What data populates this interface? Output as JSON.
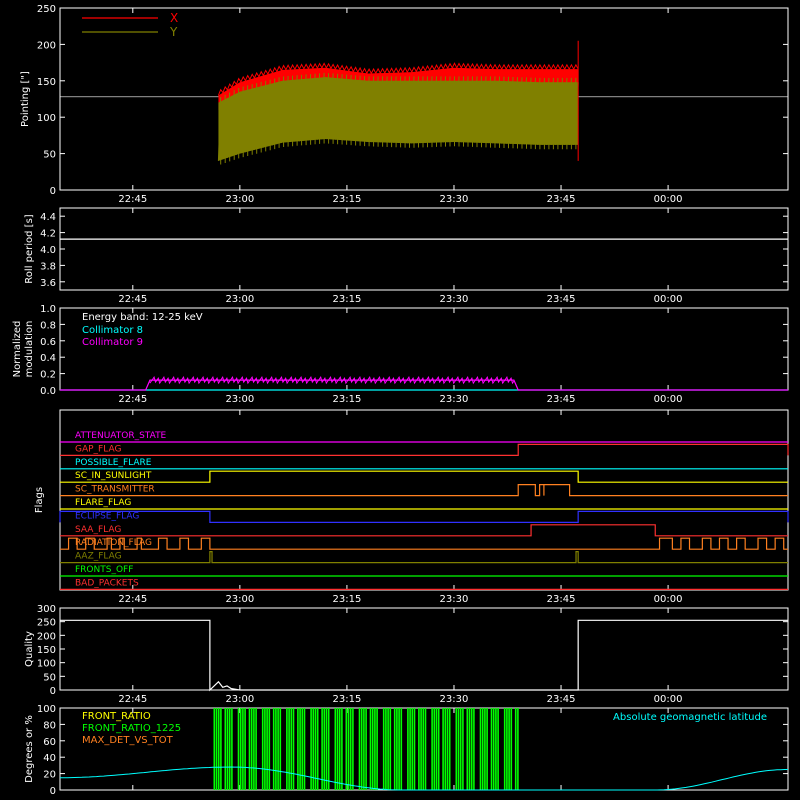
{
  "time_ticks": [
    "22:45",
    "23:00",
    "23:15",
    "23:30",
    "23:45",
    "00:00"
  ],
  "time_tick_hours": [
    22.75,
    23.0,
    23.25,
    23.5,
    23.75,
    24.0
  ],
  "time_range": [
    22.58,
    24.28
  ],
  "chart_data": [
    {
      "type": "area",
      "ylabel": "Pointing [\"]",
      "ylim": [
        0,
        250
      ],
      "yticks": [
        0,
        50,
        100,
        150,
        200,
        250
      ],
      "legend": "top-left",
      "series": [
        {
          "name": "X",
          "color": "#ff0000",
          "x": [
            22.95,
            23.0,
            23.1,
            23.2,
            23.3,
            23.4,
            23.5,
            23.6,
            23.7,
            23.79
          ],
          "upper": [
            130,
            148,
            165,
            168,
            160,
            162,
            168,
            166,
            166,
            166
          ],
          "lower": [
            110,
            130,
            145,
            146,
            140,
            142,
            148,
            146,
            146,
            145
          ]
        },
        {
          "name": "Y",
          "color": "#808000",
          "x": [
            22.95,
            23.0,
            23.1,
            23.2,
            23.3,
            23.4,
            23.5,
            23.6,
            23.7,
            23.79
          ],
          "upper": [
            120,
            135,
            150,
            155,
            150,
            150,
            150,
            150,
            148,
            148
          ],
          "lower": [
            40,
            50,
            65,
            70,
            66,
            64,
            66,
            64,
            62,
            62
          ]
        }
      ],
      "reference_level": 128
    },
    {
      "type": "line",
      "ylabel": "Roll period [s]",
      "ylim": [
        3.5,
        4.5
      ],
      "yticks": [
        3.6,
        3.8,
        4.0,
        4.2,
        4.4
      ],
      "series": [
        {
          "name": "",
          "color": "#ffffff",
          "x": [
            22.58,
            24.28
          ],
          "y": [
            4.12,
            4.12
          ]
        }
      ]
    },
    {
      "type": "line",
      "ylabel": "Normalized modulation",
      "ylim": [
        0,
        1.0
      ],
      "yticks": [
        0.0,
        0.2,
        0.4,
        0.6,
        0.8,
        1.0
      ],
      "annotation": "Energy band: 12-25 keV",
      "series": [
        {
          "name": "Collimator 8",
          "color": "#00ffff",
          "x": [
            22.58,
            24.28
          ],
          "y": [
            0.0,
            0.0
          ]
        },
        {
          "name": "Collimator 9",
          "color": "#ff00ff",
          "x": [
            22.58,
            22.78,
            22.79,
            23.64,
            23.65,
            24.28
          ],
          "y": [
            0.0,
            0.0,
            0.12,
            0.12,
            0.0,
            0.0
          ]
        }
      ]
    },
    {
      "type": "line",
      "ylabel": "Flags",
      "series": [
        {
          "name": "ATTENUATOR_STATE",
          "color": "#ff00ff",
          "segments": []
        },
        {
          "name": "GAP_FLAG",
          "color": "#ff3030",
          "segments": [
            [
              23.65,
              24.28
            ]
          ]
        },
        {
          "name": "POSSIBLE_FLARE",
          "color": "#00ffff",
          "segments": []
        },
        {
          "name": "SC_IN_SUNLIGHT",
          "color": "#ffff00",
          "segments": [
            [
              22.93,
              23.79
            ]
          ]
        },
        {
          "name": "SC_TRANSMITTER",
          "color": "#ff8020",
          "segments": [
            [
              23.65,
              23.69
            ],
            [
              23.7,
              23.71
            ],
            [
              23.71,
              23.77
            ]
          ]
        },
        {
          "name": "FLARE_FLAG",
          "color": "#ffff00",
          "segments": []
        },
        {
          "name": "ECLIPSE_FLAG",
          "color": "#3030ff",
          "segments": [
            [
              22.58,
              22.93
            ],
            [
              23.79,
              24.28
            ]
          ]
        },
        {
          "name": "SAA_FLAG",
          "color": "#ff3030",
          "segments": [
            [
              23.68,
              23.97
            ]
          ]
        },
        {
          "name": "RADIATION_FLAG",
          "color": "#ff8020",
          "segments": [
            [
              22.6,
              22.62
            ],
            [
              22.64,
              22.66
            ],
            [
              22.69,
              22.7
            ],
            [
              22.72,
              22.73
            ],
            [
              22.76,
              22.77
            ],
            [
              22.81,
              22.83
            ],
            [
              22.86,
              22.88
            ],
            [
              22.91,
              22.93
            ],
            [
              23.98,
              24.01
            ],
            [
              24.03,
              24.05
            ],
            [
              24.08,
              24.1
            ],
            [
              24.12,
              24.14
            ],
            [
              24.16,
              24.18
            ],
            [
              24.21,
              24.23
            ],
            [
              24.25,
              24.27
            ]
          ]
        },
        {
          "name": "AAZ_FLAG",
          "color": "#808000",
          "segments": [
            [
              22.93,
              22.935
            ],
            [
              23.785,
              23.79
            ]
          ]
        },
        {
          "name": "FRONTS_OFF",
          "color": "#00ff00",
          "segments": []
        },
        {
          "name": "BAD_PACKETS",
          "color": "#ff3030",
          "segments": []
        }
      ]
    },
    {
      "type": "line",
      "ylabel": "Quality",
      "ylim": [
        0,
        300
      ],
      "yticks": [
        0,
        50,
        100,
        150,
        200,
        250,
        300
      ],
      "series": [
        {
          "name": "",
          "color": "#ffffff",
          "x": [
            22.58,
            22.93,
            22.93,
            22.95,
            22.96,
            22.97,
            22.98,
            23.0,
            23.79,
            23.79,
            24.28
          ],
          "y": [
            255,
            255,
            0,
            30,
            10,
            15,
            5,
            0,
            0,
            255,
            255
          ]
        }
      ]
    },
    {
      "type": "bar",
      "ylabel": "Degrees or %",
      "ylim": [
        0,
        100
      ],
      "yticks": [
        0,
        20,
        40,
        60,
        80,
        100
      ],
      "legend": "top-left",
      "annotation": "Absolute geomagnetic latitude",
      "annotation_color": "#00ffff",
      "series": [
        {
          "name": "FRONT_RATIO",
          "color": "#ffff00"
        },
        {
          "name": "FRONT_RATIO_1225",
          "color": "#00ff00",
          "range": [
            22.93,
            23.65
          ],
          "value": 100
        },
        {
          "name": "MAX_DET_VS_TOT",
          "color": "#ff8020"
        }
      ],
      "latitude": {
        "x": [
          22.58,
          22.98,
          23.38,
          23.97,
          24.28
        ],
        "y": [
          15,
          28,
          0,
          0,
          25
        ]
      }
    }
  ]
}
